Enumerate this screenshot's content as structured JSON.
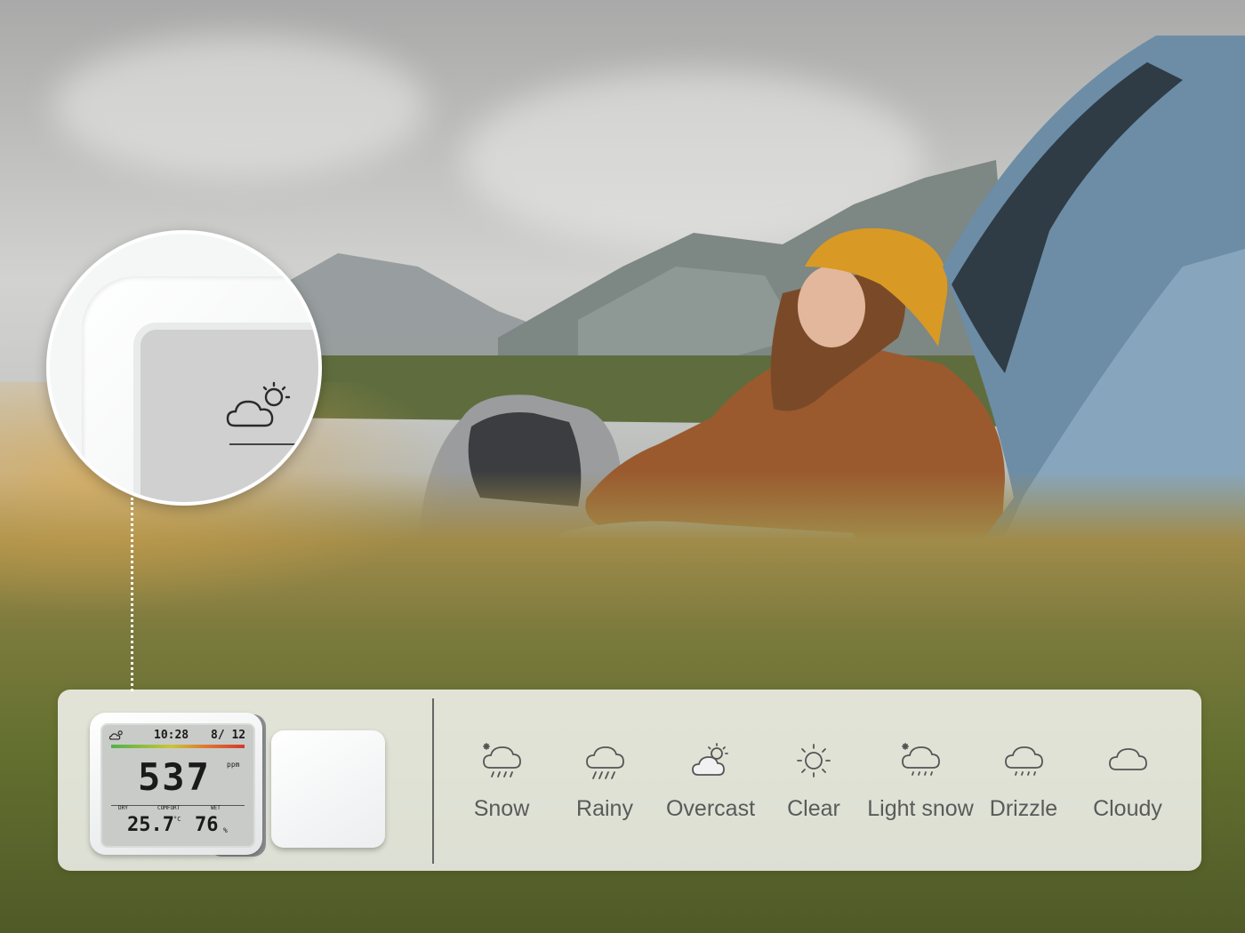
{
  "colors": {
    "panel_bg": "rgba(255,255,255,0.80)",
    "label_text": "#5a5a5a",
    "icon_stroke": "#555555",
    "magnifier_border": "#ffffff"
  },
  "device": {
    "time": "10:28",
    "date": "8/ 12",
    "co2_value": "537",
    "co2_unit": "ppm",
    "temperature": "25.7",
    "temperature_unit": "°C",
    "humidity": "76",
    "humidity_unit": "%",
    "zone_labels": [
      "DRY",
      "COMFORT",
      "WET"
    ]
  },
  "magnifier": {
    "icon": "overcast-icon"
  },
  "weather_modes": [
    {
      "label": "Snow",
      "icon": "snow-icon"
    },
    {
      "label": "Rainy",
      "icon": "rainy-icon"
    },
    {
      "label": "Overcast",
      "icon": "overcast-icon"
    },
    {
      "label": "Clear",
      "icon": "clear-icon"
    },
    {
      "label": "Light snow",
      "icon": "light-snow-icon"
    },
    {
      "label": "Drizzle",
      "icon": "drizzle-icon"
    },
    {
      "label": "Cloudy",
      "icon": "cloudy-icon"
    }
  ]
}
